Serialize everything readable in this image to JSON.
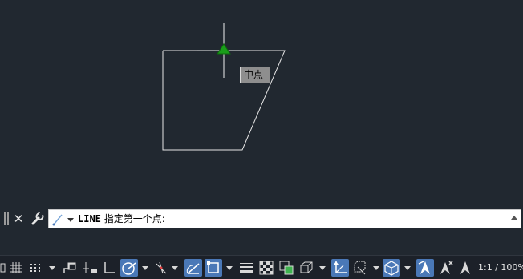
{
  "snap_tooltip": "中点",
  "command_line": {
    "command": "LINE",
    "prompt": "指定第一个点:"
  },
  "status_bar": {
    "annotation_scale": "1:1 / 100%",
    "buttons": [
      {
        "name": "model-space-icon",
        "active": false
      },
      {
        "name": "grid-icon",
        "active": false
      },
      {
        "name": "snap-mode-icon",
        "active": false
      },
      {
        "name": "infer-constraints-icon",
        "active": false
      },
      {
        "name": "dynamic-input-icon",
        "active": false
      },
      {
        "name": "ortho-icon",
        "active": false
      },
      {
        "name": "polar-tracking-icon",
        "active": true
      },
      {
        "name": "isodraft-icon",
        "active": false
      },
      {
        "name": "object-snap-tracking-icon",
        "active": true
      },
      {
        "name": "object-snap-icon",
        "active": true
      },
      {
        "name": "lineweight-icon",
        "active": false
      },
      {
        "name": "transparency-icon",
        "active": false
      },
      {
        "name": "selection-cycling-icon",
        "active": false
      },
      {
        "name": "3d-object-snap-icon",
        "active": false
      },
      {
        "name": "dynamic-ucs-icon",
        "active": true
      },
      {
        "name": "selection-filter-icon",
        "active": false
      },
      {
        "name": "gizmo-icon",
        "active": true
      },
      {
        "name": "annotation-visibility-icon",
        "active": true
      },
      {
        "name": "auto-scale-icon",
        "active": false
      },
      {
        "name": "annotation-scale-icon",
        "active": false
      }
    ]
  },
  "colors": {
    "canvas_bg": "#212830",
    "active_button": "#4a78b7",
    "snap_marker": "#1a9e1a"
  }
}
